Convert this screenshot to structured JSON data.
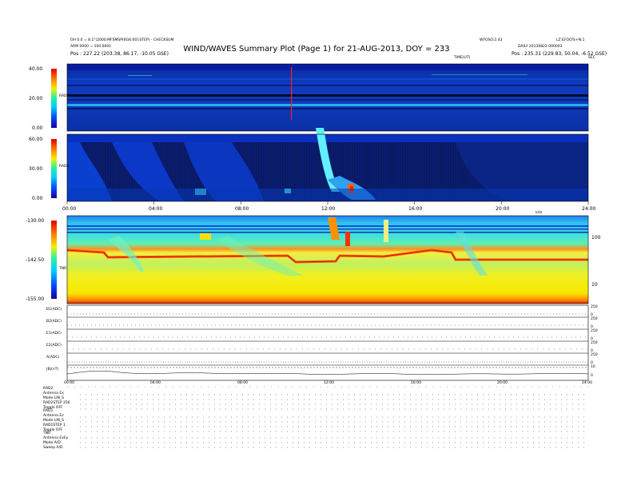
{
  "header": {
    "title": "WIND/WAVES Summary Plot (Page 1) for 21-AUG-2013, DOY = 233",
    "left_line1": "OH 0.0 = 8.1°(2000:MFSMSP[6G6:00]:STEP) - CHECKSUM",
    "left_line2": "ARM 0000 = 100.0001",
    "left_line3": "Pos :  227.22 (203.38, 86.17, -10.05 GSE)",
    "center_right_line1": "WFOSO:2.43",
    "right_line1": "LZ:EFOOTs+N:1",
    "right_line2": "DAILY 20130822:000003",
    "right_line3": "Pos :  235.31 (229.83, 50.04, -6.52 GSE)",
    "tds_label": "TIME(UT)",
    "tds_label_right": "SEC"
  },
  "panels": {
    "rad2": {
      "name": "RAD2",
      "ticks": [
        "40.00",
        "20.00",
        "0.00"
      ]
    },
    "rad1": {
      "name": "RAD1",
      "ticks": [
        "60.00",
        "30.00",
        "0.00"
      ]
    },
    "tnr": {
      "name": "TNR",
      "ticks": [
        "-130.00",
        "-142.50",
        "-155.00"
      ],
      "right_ticks": [
        "100",
        "10"
      ],
      "right_label": "kHz"
    }
  },
  "time_axis": {
    "ticks": [
      "00:00",
      "04:00",
      "08:00",
      "12:00",
      "16:00",
      "20:00",
      "24:00"
    ]
  },
  "bottom_panels": [
    {
      "label": "B1(ADC)",
      "ticks": [
        "250",
        "0"
      ]
    },
    {
      "label": "B2(ADC)",
      "ticks": [
        "250",
        "0"
      ]
    },
    {
      "label": "E1(ADC)",
      "ticks": [
        "250",
        "0"
      ]
    },
    {
      "label": "E2(ADC)",
      "ticks": [
        "250",
        "0"
      ]
    },
    {
      "label": "A(ADC)",
      "ticks": [
        "250",
        "0"
      ]
    },
    {
      "label": "|B|(nT)",
      "ticks": [
        "10",
        "0"
      ]
    }
  ],
  "status_labels": {
    "rad2_group": [
      "RAD2",
      "Antenna  Ex",
      "Mode  LIN_S",
      "RAD2STEP 256",
      "Toggle  OFF"
    ],
    "rad1_group": [
      "RAD1",
      "Antenna  Ez",
      "Mode  LIN_S",
      "RAD1STEP 1",
      "Toggle  OFF"
    ],
    "tnr_group": [
      "TNR",
      "Antenna  ExEy",
      "Mode  A/D",
      "Sweep  A/D"
    ]
  },
  "chart_data": {
    "type": "heatmap",
    "title": "WIND/WAVES Summary Plot (Page 1) for 21-AUG-2013, DOY = 233",
    "x_range_hours": [
      0,
      24
    ],
    "panels": [
      {
        "name": "RAD2",
        "colorbar_range": [
          0,
          40
        ]
      },
      {
        "name": "RAD1",
        "colorbar_range": [
          0,
          60
        ]
      },
      {
        "name": "TNR",
        "colorbar_range": [
          -155,
          -130
        ],
        "y_ticks_kHz": [
          100,
          10
        ]
      }
    ]
  },
  "colors": {
    "bg_dark_blue": "#0a2fb0",
    "black": "#000000",
    "yellow": "#ffe800",
    "red": "#e02000",
    "cyan": "#30c8f0"
  }
}
